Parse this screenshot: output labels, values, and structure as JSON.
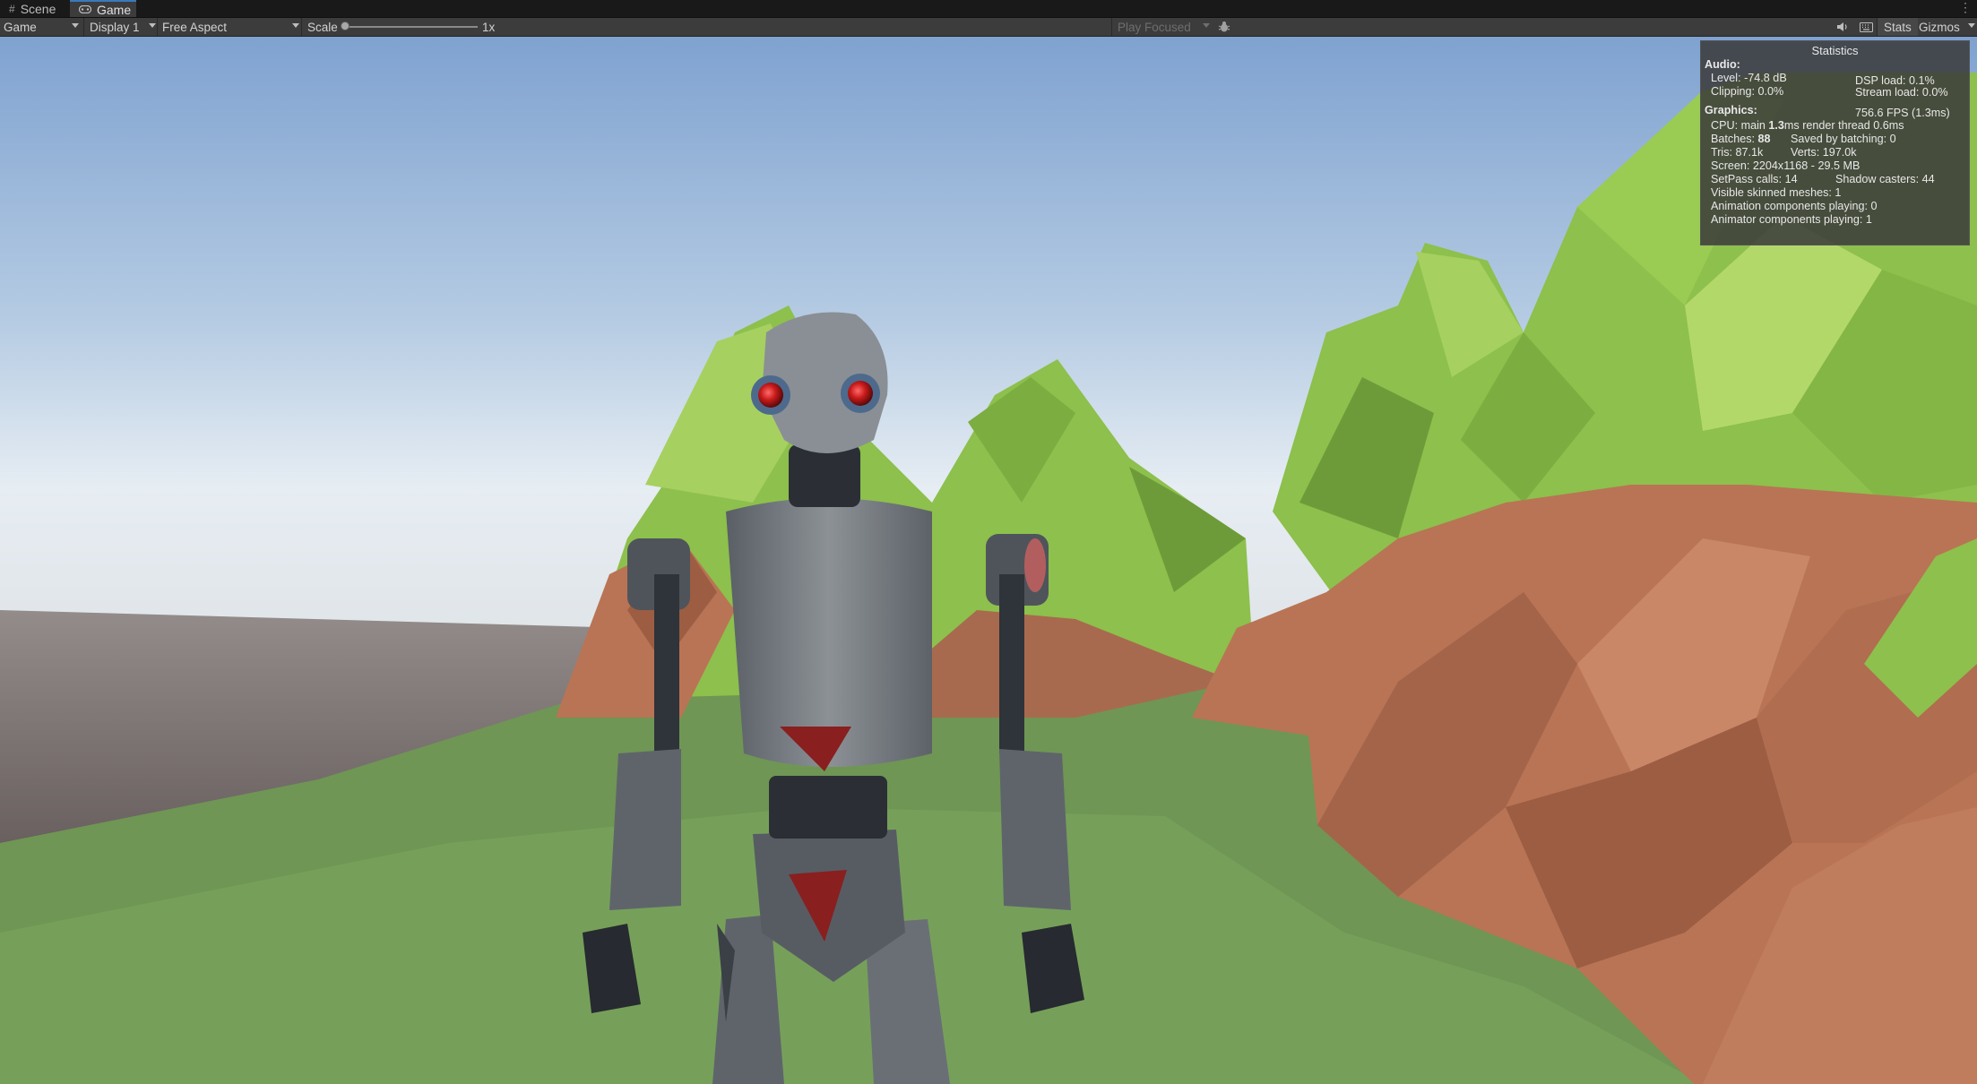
{
  "tabs": [
    {
      "label": "Scene",
      "icon": "hash-icon"
    },
    {
      "label": "Game",
      "icon": "gamepad-icon"
    }
  ],
  "toolbar": {
    "view_mode": "Game",
    "display": "Display 1",
    "aspect": "Free Aspect",
    "scale_label": "Scale",
    "scale_value": "1x",
    "scale_level": 0.0,
    "play_mode": "Play Focused",
    "stats_label": "Stats",
    "gizmos_label": "Gizmos"
  },
  "statistics": {
    "title": "Statistics",
    "audio_heading": "Audio:",
    "level": "Level: -74.8 dB",
    "clipping": "Clipping: 0.0%",
    "dsp_load": "DSP load: 0.1%",
    "stream_load": "Stream load: 0.0%",
    "graphics_heading": "Graphics:",
    "fps": "756.6 FPS (1.3ms)",
    "cpu_prefix": "CPU: main ",
    "cpu_main": "1.3",
    "cpu_suffix": "ms  render thread 0.6ms",
    "batches_prefix": "Batches: ",
    "batches": "88",
    "saved_by_batching": "Saved by batching: 0",
    "tris": "Tris: 87.1k",
    "verts": "Verts: 197.0k",
    "screen": "Screen: 2204x1168 - 29.5 MB",
    "setpass": "SetPass calls: 14",
    "shadow_casters": "Shadow casters: 44",
    "visible_skinned": "Visible skinned meshes: 1",
    "animation_components": "Animation components playing: 0",
    "animator_components": "Animator components playing: 1"
  },
  "colors": {
    "sky_top": "#7fa2d0",
    "sky_horizon": "#e6edf3",
    "ground": "#6f9654",
    "foliage": "#8dc04c",
    "rock": "#b97455",
    "robot_body": "#6f7479",
    "robot_eye": "#c81a1a",
    "editor_bg": "#3c3c3c",
    "tab_accent": "#3a79bb"
  }
}
